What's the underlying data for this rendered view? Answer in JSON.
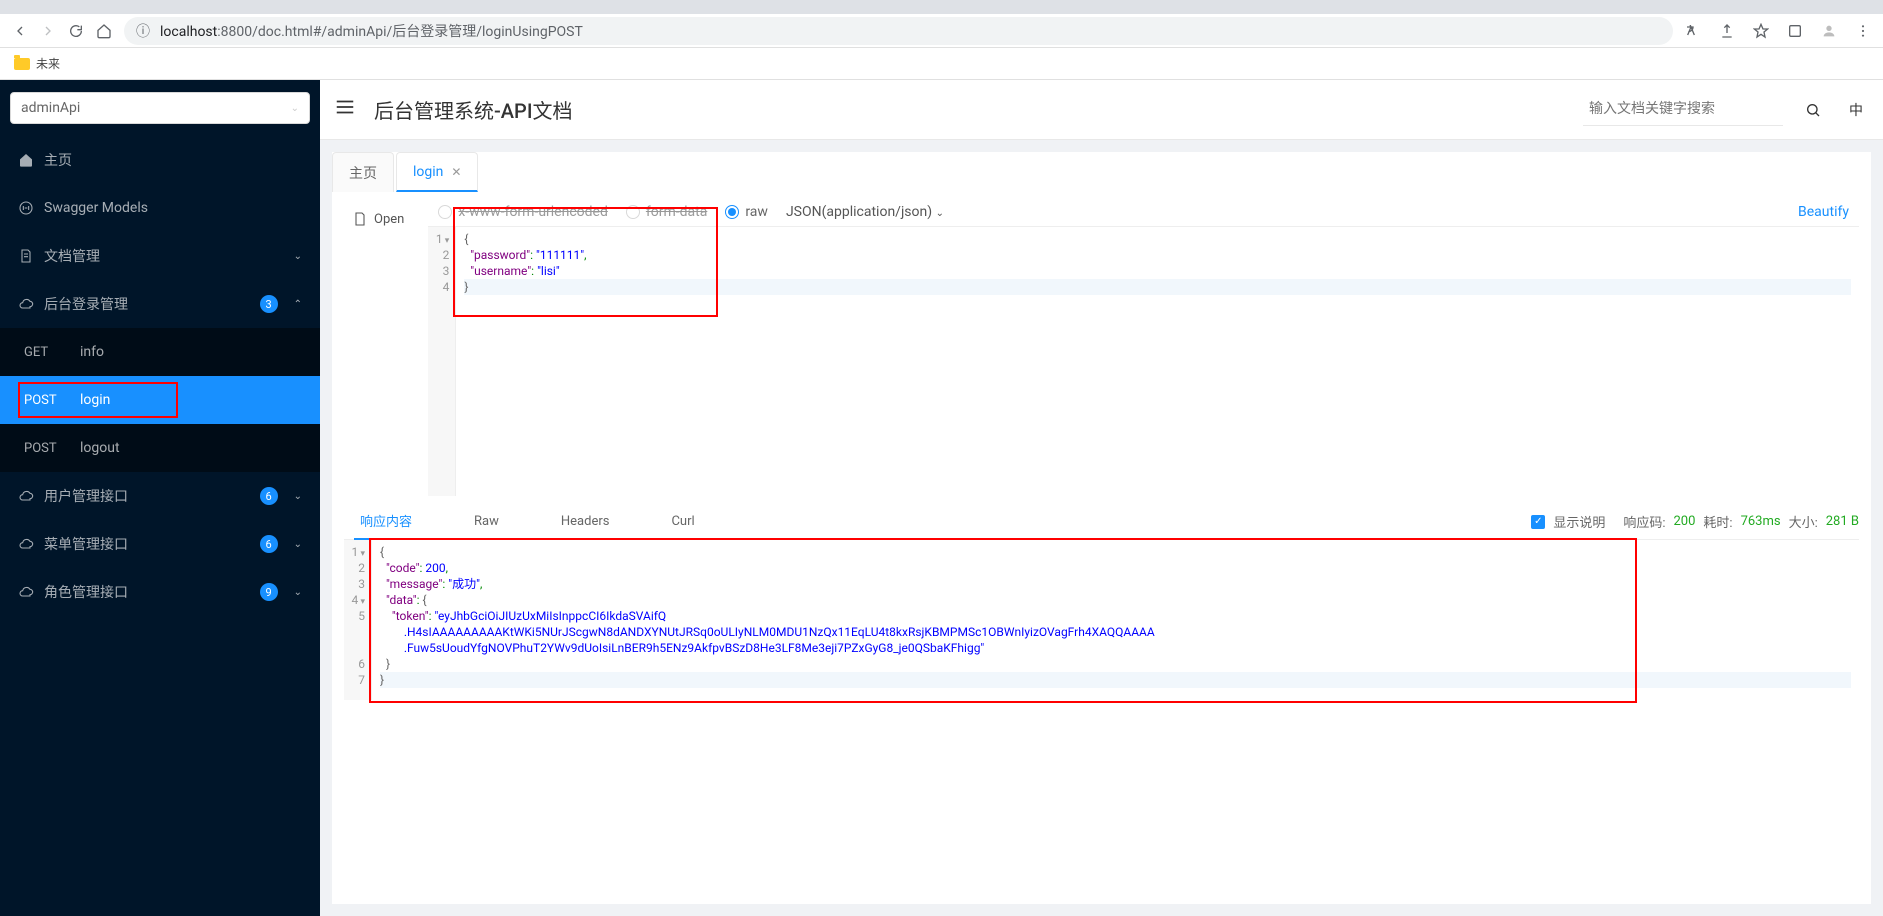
{
  "browser": {
    "url_host": "localhost",
    "url_path": ":8800/doc.html#/adminApi/后台登录管理/loginUsingPOST",
    "bookmark": "未来",
    "info_icon_text": "ⓘ"
  },
  "sidebar": {
    "api_select": "adminApi",
    "items": [
      {
        "icon": "home",
        "label": "主页"
      },
      {
        "icon": "swagger",
        "label": "Swagger Models"
      },
      {
        "icon": "doc",
        "label": "文档管理",
        "expandable": true,
        "open": false
      },
      {
        "icon": "cloud",
        "label": "后台登录管理",
        "badge": "3",
        "expandable": true,
        "open": true
      },
      {
        "icon": "cloud",
        "label": "用户管理接口",
        "badge": "6",
        "expandable": true,
        "open": false
      },
      {
        "icon": "cloud",
        "label": "菜单管理接口",
        "badge": "6",
        "expandable": true,
        "open": false
      },
      {
        "icon": "cloud",
        "label": "角色管理接口",
        "badge": "9",
        "expandable": true,
        "open": false
      }
    ],
    "login_submenu": [
      {
        "method": "GET",
        "name": "info"
      },
      {
        "method": "POST",
        "name": "login",
        "active": true
      },
      {
        "method": "POST",
        "name": "logout"
      }
    ]
  },
  "header": {
    "title": "后台管理系统-API文档",
    "search_placeholder": "输入文档关键字搜索",
    "lang_symbol": "中"
  },
  "tabs": [
    {
      "label": "主页",
      "active": false,
      "closable": false
    },
    {
      "label": "login",
      "active": true,
      "closable": true
    }
  ],
  "request": {
    "open_button": "Open",
    "body_types": {
      "form_urlencoded": "x-www-form-urlencoded",
      "form_data": "form-data",
      "raw": "raw"
    },
    "content_type": "JSON(application/json)",
    "beautify": "Beautify",
    "body_lines": [
      "{",
      "  \"password\": \"111111\",",
      "  \"username\": \"lisi\"",
      "}"
    ]
  },
  "response": {
    "tabs": {
      "content": "响应内容",
      "raw": "Raw",
      "headers": "Headers",
      "curl": "Curl"
    },
    "meta": {
      "show_desc": "显示说明",
      "status_label": "响应码:",
      "status_val": "200",
      "time_label": "耗时:",
      "time_val": "763ms",
      "size_label": "大小:",
      "size_val": "281 B"
    },
    "body_lines_count": 7,
    "body": {
      "l1": "{",
      "l2_key": "\"code\"",
      "l2_val": "200",
      "l2_colon": ": ",
      "l2_comma": ",",
      "l3_key": "\"message\"",
      "l3_val": "\"成功\"",
      "l4_key": "\"data\"",
      "l4_brace": "{",
      "l5_key": "\"token\"",
      "l5_val1": "\"eyJhbGciOiJIUzUxMiIsInppcCI6IkdaSVAifQ",
      "l5_val2": ".H4sIAAAAAAAAAKtWKi5NUrJScgwN8dANDXYNUtJRSq0oULIyNLM0MDU1NzQx11EqLU4t8kxRsjKBMPMSc1OBWnIyizOVagFrh4XAQQAAAA",
      "l5_val3": ".Fuw5sUoudYfgNOVPhuT2YWv9dUoIsiLnBER9h5ENz9AkfpvBSzD8He3LF8Me3eji7PZxGyG8_je0QSbaKFhigg\"",
      "l6": "}",
      "l7": "}"
    }
  }
}
